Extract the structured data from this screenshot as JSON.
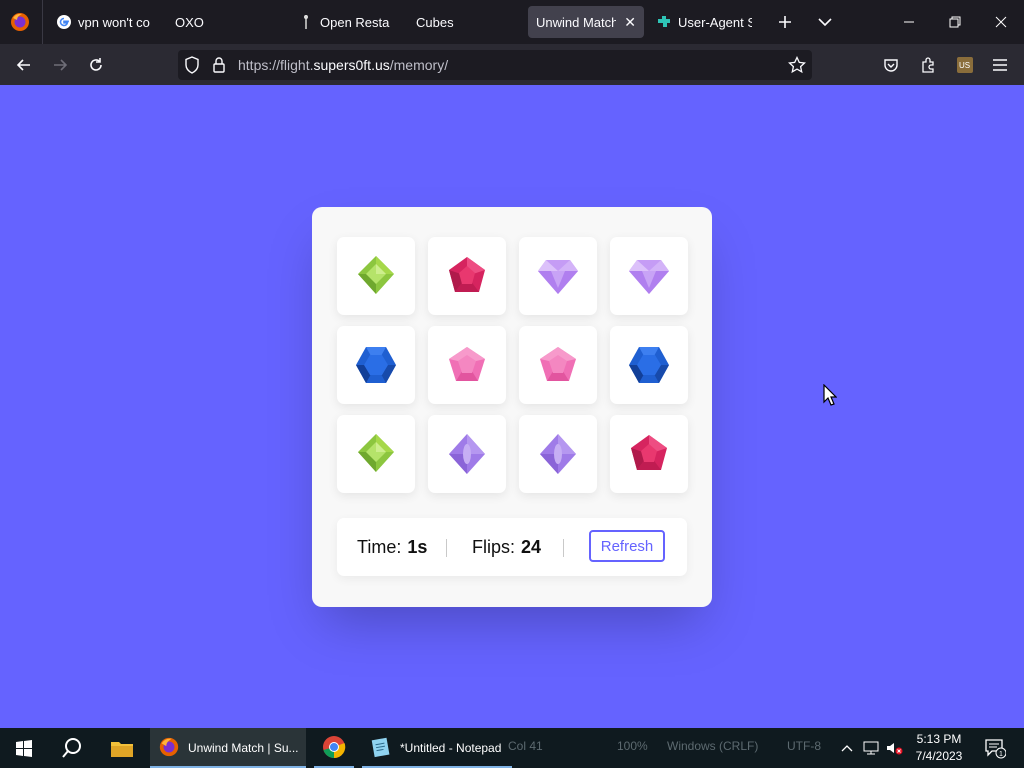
{
  "browser": {
    "tabs": [
      {
        "title": "vpn won't co",
        "icon": "google-icon"
      },
      {
        "title": "OXO",
        "icon": ""
      },
      {
        "title": "Open Restaura",
        "icon": "pin-icon"
      },
      {
        "title": "Cubes",
        "icon": ""
      },
      {
        "title": "Unwind Match",
        "icon": "",
        "active": true
      },
      {
        "title": "User-Agent Sw",
        "icon": "puzzle-icon"
      }
    ],
    "url_prefix": "https://flight.",
    "url_domain": "supers0ft.us",
    "url_path": "/memory/"
  },
  "game": {
    "gems": [
      "green",
      "ruby",
      "lavender-diamond",
      "lavender-diamond",
      "blue",
      "pink",
      "pink",
      "blue",
      "green",
      "violet",
      "violet",
      "ruby"
    ],
    "time_label": "Time:",
    "time_value": "1s",
    "flips_label": "Flips:",
    "flips_value": "24",
    "refresh_label": "Refresh"
  },
  "taskbar": {
    "apps": [
      {
        "label": "Unwind Match | Su...",
        "icon": "firefox-icon",
        "active": true
      },
      {
        "label": "",
        "icon": "chrome-icon"
      },
      {
        "label": "*Untitled - Notepad",
        "icon": "notepad-icon"
      }
    ],
    "ghost_text": [
      "Col 41",
      "100%",
      "Windows (CRLF)",
      "UTF-8"
    ],
    "time": "5:13 PM",
    "date": "7/4/2023",
    "notification_count": "1"
  },
  "colors": {
    "page_bg": "#6563ff",
    "accent": "#6563ff"
  }
}
